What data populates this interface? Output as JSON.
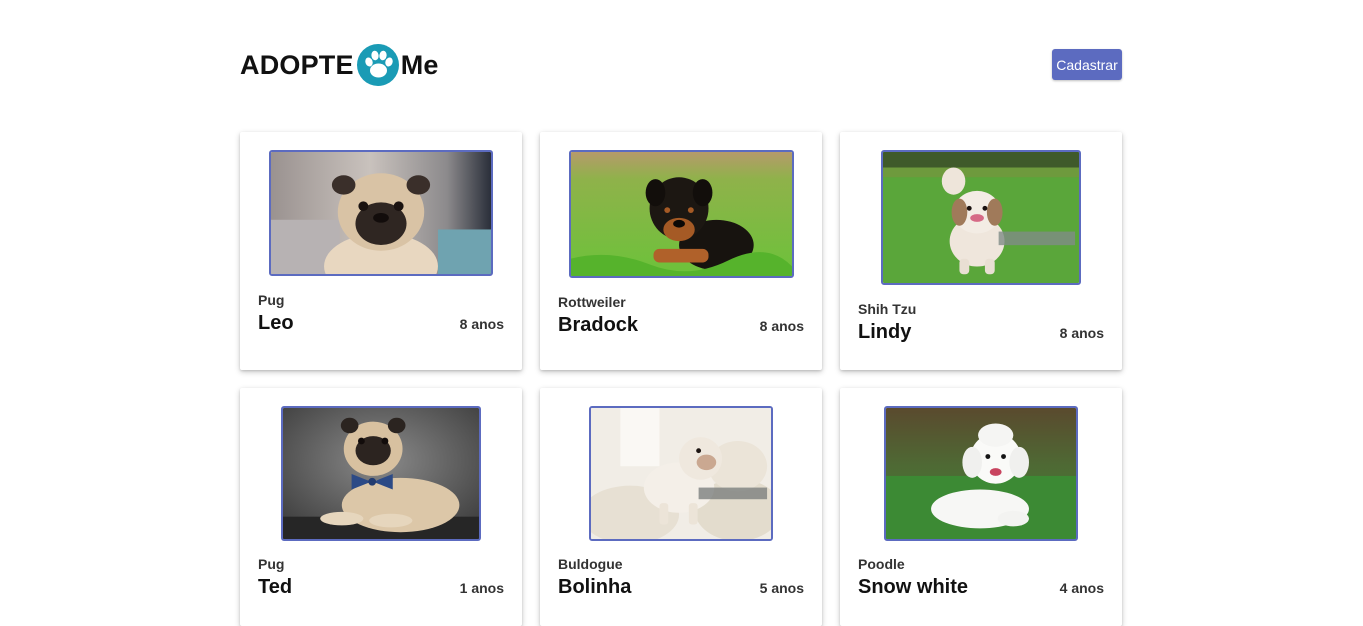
{
  "brand": {
    "logo_left": "ADOPTE",
    "logo_right": "Me",
    "paw_color": "#1a9bb5"
  },
  "header": {
    "register_label": "Cadastrar"
  },
  "pets": [
    {
      "breed": "Pug",
      "name": "Leo",
      "age": "8 anos",
      "photo": "pug-photo"
    },
    {
      "breed": "Rottweiler",
      "name": "Bradock",
      "age": "8 anos",
      "photo": "rottweiler-puppy-photo"
    },
    {
      "breed": "Shih Tzu",
      "name": "Lindy",
      "age": "8 anos",
      "photo": "shih-tzu-photo"
    },
    {
      "breed": "Pug",
      "name": "Ted",
      "age": "1 anos",
      "photo": "pug-with-bowtie-photo"
    },
    {
      "breed": "Buldogue",
      "name": "Bolinha",
      "age": "5 anos",
      "photo": "bulldog-photo"
    },
    {
      "breed": "Poodle",
      "name": "Snow white",
      "age": "4 anos",
      "photo": "poodle-photo"
    }
  ],
  "colors": {
    "accent": "#5c6bc0"
  }
}
